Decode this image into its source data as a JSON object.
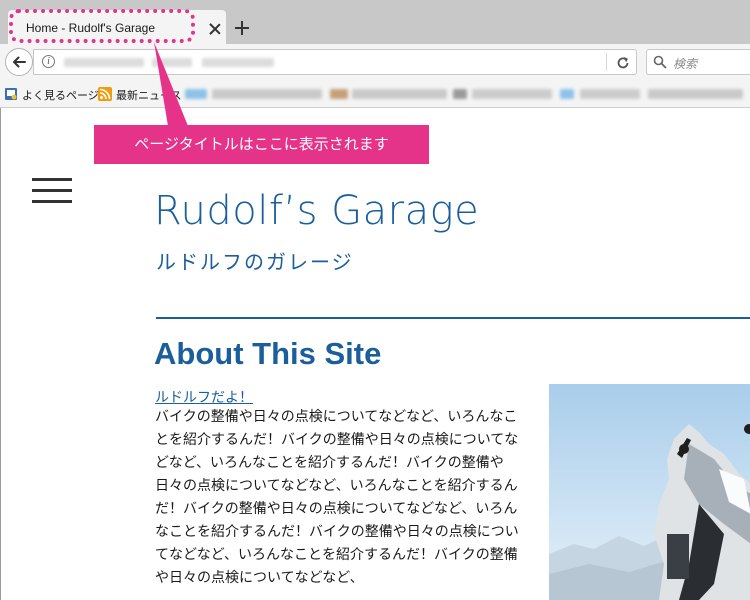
{
  "browser": {
    "tab": {
      "title": "Home - Rudolf's Garage"
    },
    "search": {
      "placeholder": "検索"
    },
    "bookmarks": [
      {
        "label": "よく見るページ",
        "icon": "bookmark-page-icon"
      },
      {
        "label": "最新ニュース",
        "icon": "rss-feed-icon"
      }
    ]
  },
  "annotation": {
    "callout_text": "ページタイトルはここに表示されます",
    "color": "#e6338a"
  },
  "site": {
    "title": "Rudolf’s Garage",
    "subtitle": "ルドルフのガレージ",
    "accent_color": "#1a5e9c"
  },
  "content": {
    "section_heading": "About This Site",
    "link_text": "ルドルフだよ！",
    "body_text": "バイクの整備や日々の点検についてなどなど、いろんなことを紹介するんだ！バイクの整備や日々の点検についてなどなど、いろんなことを紹介するんだ！バイクの整備や日々の点検についてなどなど、いろんなことを紹介するんだ！バイクの整備や日々の点検についてなどなど、いろんなことを紹介するんだ！バイクの整備や日々の点検についてなどなど、いろんなことを紹介するんだ！バイクの整備や日々の点検についてなどなど、",
    "photo": "motorcycle-photo"
  }
}
